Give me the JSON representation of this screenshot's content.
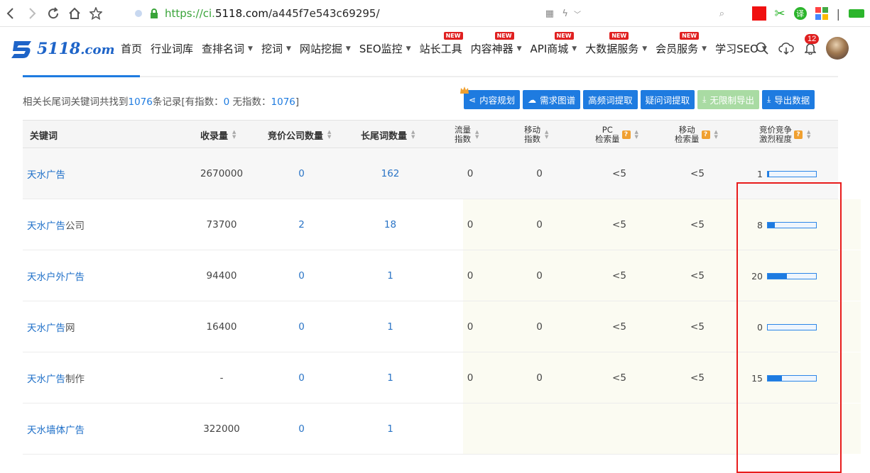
{
  "browser": {
    "url_prefix": "https://ci.",
    "url_host": "5118.com",
    "url_path": "/a445f7e543c69295/"
  },
  "site": {
    "logo": "5118",
    "logo_suffix": ".com",
    "nav": [
      {
        "label": "首页",
        "caret": false,
        "new": false
      },
      {
        "label": "行业词库",
        "caret": false,
        "new": false
      },
      {
        "label": "查排名词",
        "caret": true,
        "new": false
      },
      {
        "label": "挖词",
        "caret": true,
        "new": false
      },
      {
        "label": "网站挖掘",
        "caret": true,
        "new": false
      },
      {
        "label": "SEO监控",
        "caret": true,
        "new": false
      },
      {
        "label": "站长工具",
        "caret": false,
        "new": true
      },
      {
        "label": "内容神器",
        "caret": true,
        "new": true
      },
      {
        "label": "API商城",
        "caret": true,
        "new": true
      },
      {
        "label": "大数据服务",
        "caret": true,
        "new": true
      },
      {
        "label": "会员服务",
        "caret": true,
        "new": true
      },
      {
        "label": "学习SEO",
        "caret": true,
        "new": false
      }
    ],
    "new_badge": "NEW",
    "notification_count": "12"
  },
  "summary": {
    "prefix": "相关长尾词关键词共找到",
    "total": "1076",
    "mid": "条记录[有指数：",
    "with_index": "0",
    "mid2": " 无指数：",
    "without_index": "1076",
    "suffix": "]"
  },
  "toolbar": {
    "content_plan": "内容规划",
    "demand_map": "需求图谱",
    "high_freq": "高频词提取",
    "question": "疑问词提取",
    "unlimited_export": "无限制导出",
    "export": "导出数据"
  },
  "table": {
    "headers": {
      "keyword": "关键词",
      "indexed": "收录量",
      "bid_companies": "竞价公司数量",
      "longtail": "长尾词数量",
      "traffic_1": "流量",
      "traffic_2": "指数",
      "mobile_1": "移动",
      "mobile_2": "指数",
      "pc_1": "PC",
      "pc_2": "检索量",
      "mobsearch_1": "移动",
      "mobsearch_2": "检索量",
      "compete_1": "竞价竞争",
      "compete_2": "激烈程度"
    },
    "rows": [
      {
        "kw_main": "天水广告",
        "kw_rest": "",
        "indexed": "2670000",
        "bid": "0",
        "longtail": "162",
        "traffic": "0",
        "mobile_idx": "0",
        "pc": "<5",
        "mobile_search": "<5",
        "compete": "1",
        "compete_pct": 0.02
      },
      {
        "kw_main": "天水广告",
        "kw_rest": "公司",
        "indexed": "73700",
        "bid": "2",
        "longtail": "18",
        "traffic": "0",
        "mobile_idx": "0",
        "pc": "<5",
        "mobile_search": "<5",
        "compete": "8",
        "compete_pct": 0.14
      },
      {
        "kw_main": "天水户外广告",
        "kw_rest": "",
        "indexed": "94400",
        "bid": "0",
        "longtail": "1",
        "traffic": "0",
        "mobile_idx": "0",
        "pc": "<5",
        "mobile_search": "<5",
        "compete": "20",
        "compete_pct": 0.4
      },
      {
        "kw_main": "天水广告",
        "kw_rest": "网",
        "indexed": "16400",
        "bid": "0",
        "longtail": "1",
        "traffic": "0",
        "mobile_idx": "0",
        "pc": "<5",
        "mobile_search": "<5",
        "compete": "0",
        "compete_pct": 0
      },
      {
        "kw_main": "天水广告",
        "kw_rest": "制作",
        "indexed": "-",
        "bid": "0",
        "longtail": "1",
        "traffic": "0",
        "mobile_idx": "0",
        "pc": "<5",
        "mobile_search": "<5",
        "compete": "15",
        "compete_pct": 0.3
      },
      {
        "kw_main": "天水墙体广告",
        "kw_rest": "",
        "indexed": "322000",
        "bid": "0",
        "longtail": "1",
        "traffic": "",
        "mobile_idx": "",
        "pc": "",
        "mobile_search": "",
        "compete": "",
        "compete_pct": null
      }
    ]
  },
  "colors": {
    "accent": "#1e7be0",
    "highlight_box": "#e81c1c",
    "new_badge": "#e02020",
    "disabled_button": "#a9dba3"
  }
}
